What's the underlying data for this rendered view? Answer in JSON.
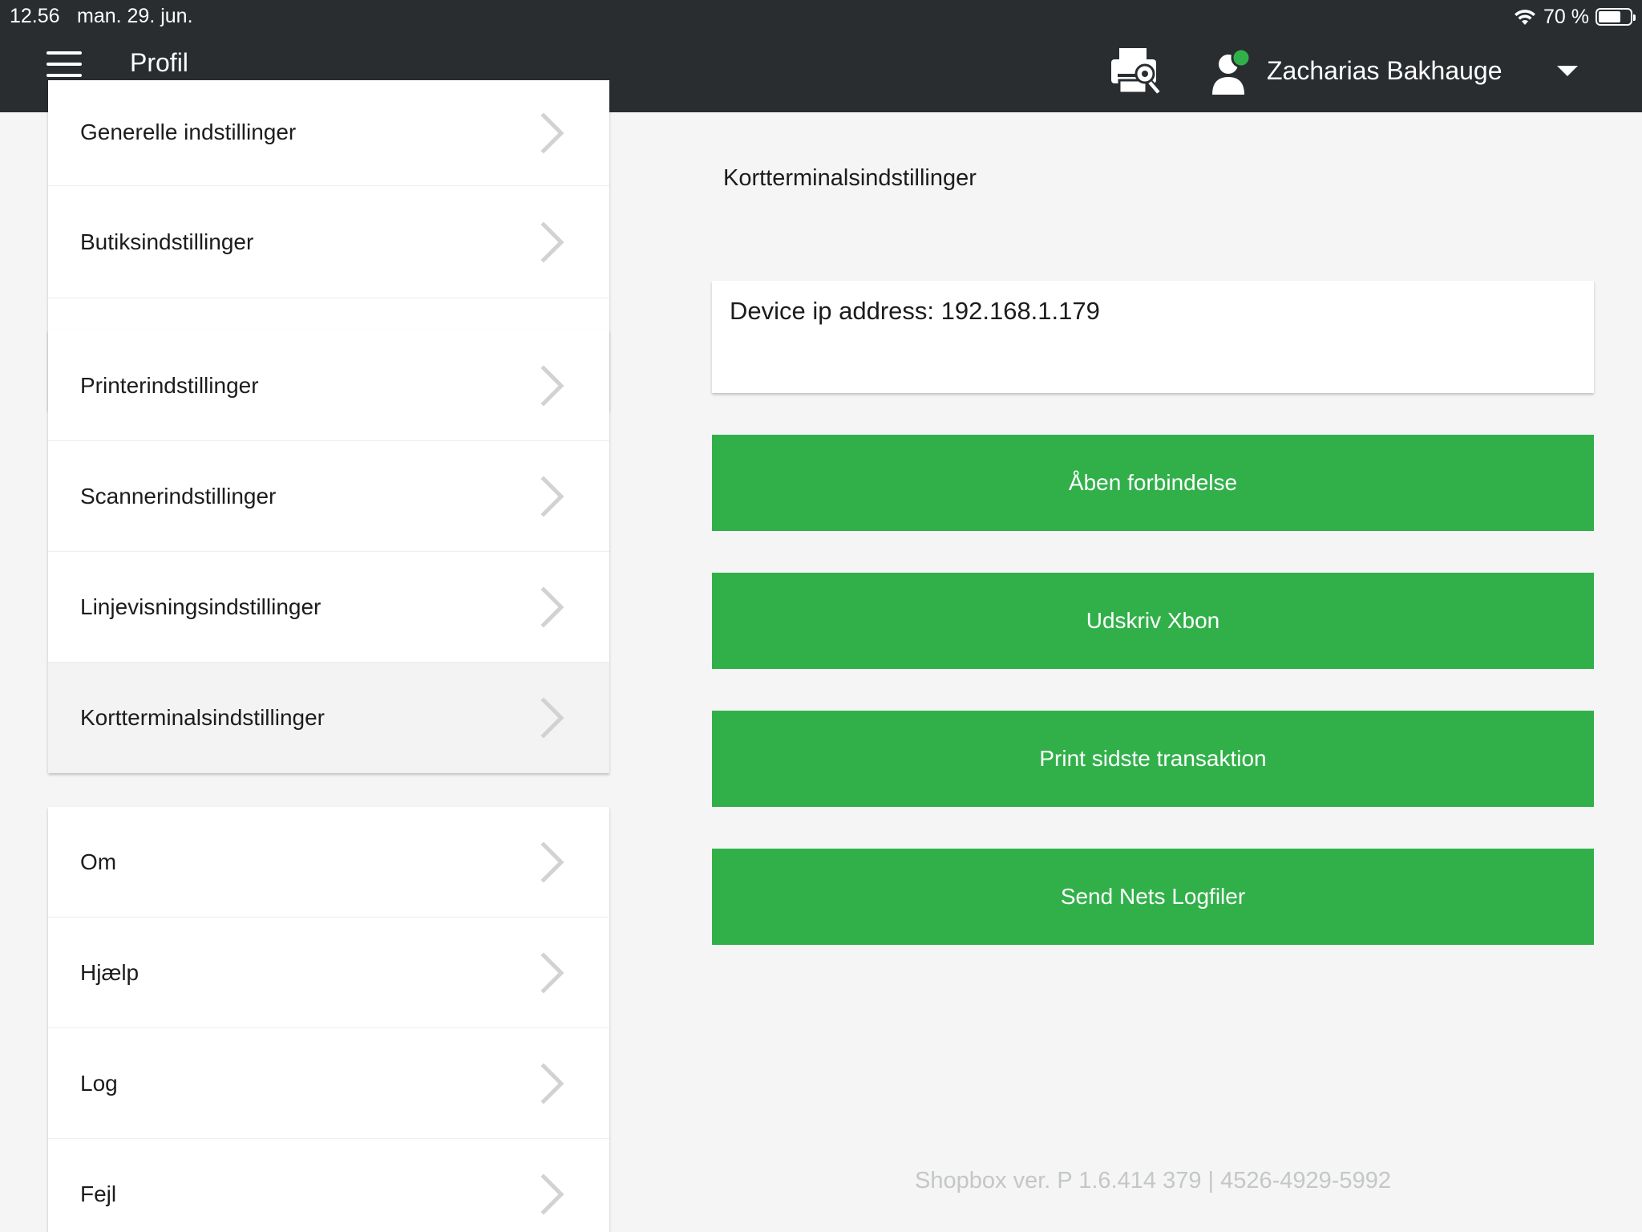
{
  "status_bar": {
    "time": "12.56",
    "date": "man. 29. jun.",
    "battery": "70 %",
    "battery_level": 0.7
  },
  "header": {
    "title": "Profil",
    "user_name": "Zacharias Bakhauge"
  },
  "sidebar": {
    "group1": [
      {
        "label": "Generelle indstillinger"
      },
      {
        "label": "Butiksindstillinger"
      }
    ],
    "group2": [
      {
        "label": "Printerindstillinger"
      },
      {
        "label": "Scannerindstillinger"
      },
      {
        "label": "Linjevisningsindstillinger"
      },
      {
        "label": "Kortterminalsindstillinger",
        "active": true
      }
    ],
    "group3": [
      {
        "label": "Om"
      },
      {
        "label": "Hjælp"
      },
      {
        "label": "Log"
      },
      {
        "label": "Fejl"
      }
    ]
  },
  "main": {
    "title": "Kortterminalsindstillinger",
    "device_ip": "Device ip address: 192.168.1.179",
    "buttons": [
      {
        "label": "Åben forbindelse"
      },
      {
        "label": "Udskriv Xbon"
      },
      {
        "label": "Print sidste transaktion"
      },
      {
        "label": "Send Nets Logfiler"
      }
    ],
    "version": "Shopbox ver. P 1.6.414 379 | 4526-4929-5992"
  },
  "colors": {
    "topbar": "#292d30",
    "accent_green": "#31b04a",
    "background": "#f4f5f4"
  }
}
